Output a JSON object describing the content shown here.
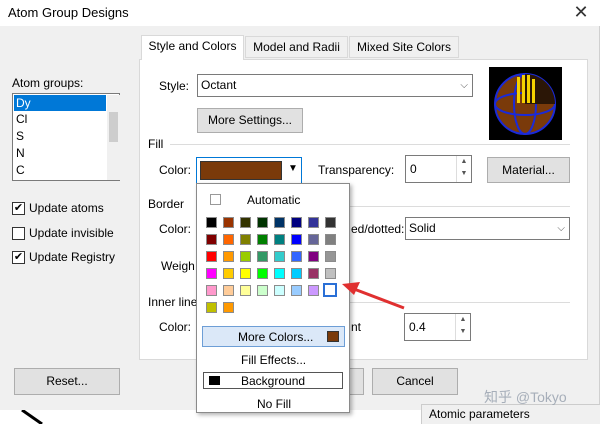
{
  "window": {
    "title": "Atom Group Designs",
    "close_glyph": "✕"
  },
  "left": {
    "groups_label": "Atom groups:",
    "groups": [
      "Dy",
      "Cl",
      "S",
      "N",
      "C"
    ],
    "selected_group": "Dy",
    "checkboxes": [
      {
        "label": "Update atoms",
        "checked": true
      },
      {
        "label": "Update invisible",
        "checked": false
      },
      {
        "label": "Update Registry",
        "checked": true
      }
    ]
  },
  "tabs": [
    "Style and Colors",
    "Model and Radii",
    "Mixed Site Colors"
  ],
  "style_row": {
    "label": "Style:",
    "value": "Octant"
  },
  "more_settings_label": "More Settings...",
  "fill": {
    "section": "Fill",
    "color_label": "Color:",
    "color_value": "#7a3a0a",
    "transparency_label": "Transparency:",
    "transparency_value": "0",
    "material_label": "Material..."
  },
  "border": {
    "section": "Border",
    "color_label_fragment": "Color:",
    "dashed_label_fragment": "ed/dotted:",
    "dashed_value": "Solid",
    "weight_label_fragment": "Weigh"
  },
  "inner": {
    "section_fragment": "Inner line",
    "color_label_fragment": "Color:",
    "height_label_fragment": "nt",
    "height_value": "0.4"
  },
  "buttons": {
    "reset": "Reset...",
    "cancel": "Cancel"
  },
  "popup": {
    "automatic": "Automatic",
    "more_colors": "More Colors...",
    "fill_effects": "Fill Effects...",
    "background": "Background",
    "no_fill": "No Fill",
    "palette": [
      [
        "#000000",
        "#993300",
        "#333300",
        "#003300",
        "#003366",
        "#000080",
        "#333399",
        "#333333"
      ],
      [
        "#800000",
        "#ff6600",
        "#808000",
        "#008000",
        "#008080",
        "#0000ff",
        "#666699",
        "#808080"
      ],
      [
        "#ff0000",
        "#ff9900",
        "#99cc00",
        "#339966",
        "#33cccc",
        "#3366ff",
        "#800080",
        "#969696"
      ],
      [
        "#ff00ff",
        "#ffcc00",
        "#ffff00",
        "#00ff00",
        "#00ffff",
        "#00ccff",
        "#993366",
        "#c0c0c0"
      ],
      [
        "#ff99cc",
        "#ffcc99",
        "#ffff99",
        "#ccffcc",
        "#ccffff",
        "#99ccff",
        "#cc99ff",
        "#ffffff"
      ],
      [
        "#c0c000",
        "#ff9900"
      ]
    ],
    "more_colors_swatch": "#7a3a0a"
  },
  "footer": {
    "panel_label": "Atomic parameters",
    "watermark": "知乎 @Tokyo"
  },
  "colors": {
    "accent": "#0078d7",
    "arrow": "#e03030"
  }
}
